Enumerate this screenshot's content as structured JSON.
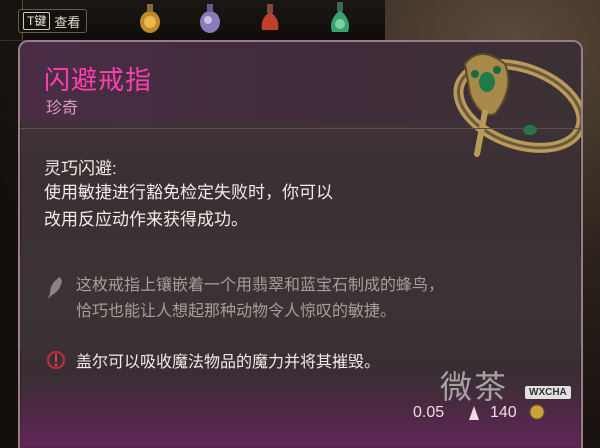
{
  "toolbar": {
    "key": "T键",
    "inspect_label": "查看",
    "items": [
      "potion-icon",
      "potion-icon",
      "potion-icon",
      "potion-icon"
    ]
  },
  "item": {
    "name": "闪避戒指",
    "rarity": "珍奇",
    "effect_title": "灵巧闪避:",
    "effect_lines": [
      "使用敏捷进行豁免检定失败时，你可以",
      "改用反应动作来获得成功。"
    ],
    "flavor_lines": [
      "这枚戒指上镶嵌着一个用翡翠和蓝宝石制成的蜂鸟，",
      "恰巧也能让人想起那种动物令人惊叹的敏捷。"
    ],
    "warning": "盖尔可以吸收魔法物品的魔力并将其摧毁。",
    "weight": "0.05",
    "value": "140"
  },
  "watermark": {
    "text": "微茶",
    "badge": "WXCHA"
  },
  "colors": {
    "title": "#ff3fb2",
    "rarity": "#d89abf",
    "body_text": "#f1ebe4",
    "flavor_text": "#a89e97",
    "panel_border": "#9a7e8a"
  }
}
